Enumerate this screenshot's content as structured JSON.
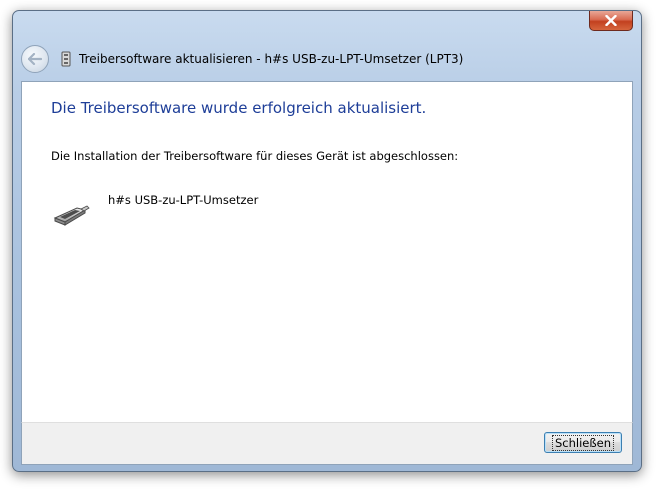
{
  "window": {
    "title": "Treibersoftware aktualisieren - h#s USB-zu-LPT-Umsetzer (LPT3)",
    "close_icon": "close-icon",
    "back_icon": "back-arrow-icon"
  },
  "content": {
    "heading": "Die Treibersoftware wurde erfolgreich aktualisiert.",
    "info": "Die Installation der Treibersoftware für dieses Gerät ist abgeschlossen:",
    "device_name": "h#s USB-zu-LPT-Umsetzer",
    "device_icon": "parallel-port-adapter-icon"
  },
  "footer": {
    "close_button_label": "Schließen"
  },
  "colors": {
    "heading": "#1e3e98",
    "close_button_red": "#c2401f",
    "frame": "#a8c1de"
  }
}
